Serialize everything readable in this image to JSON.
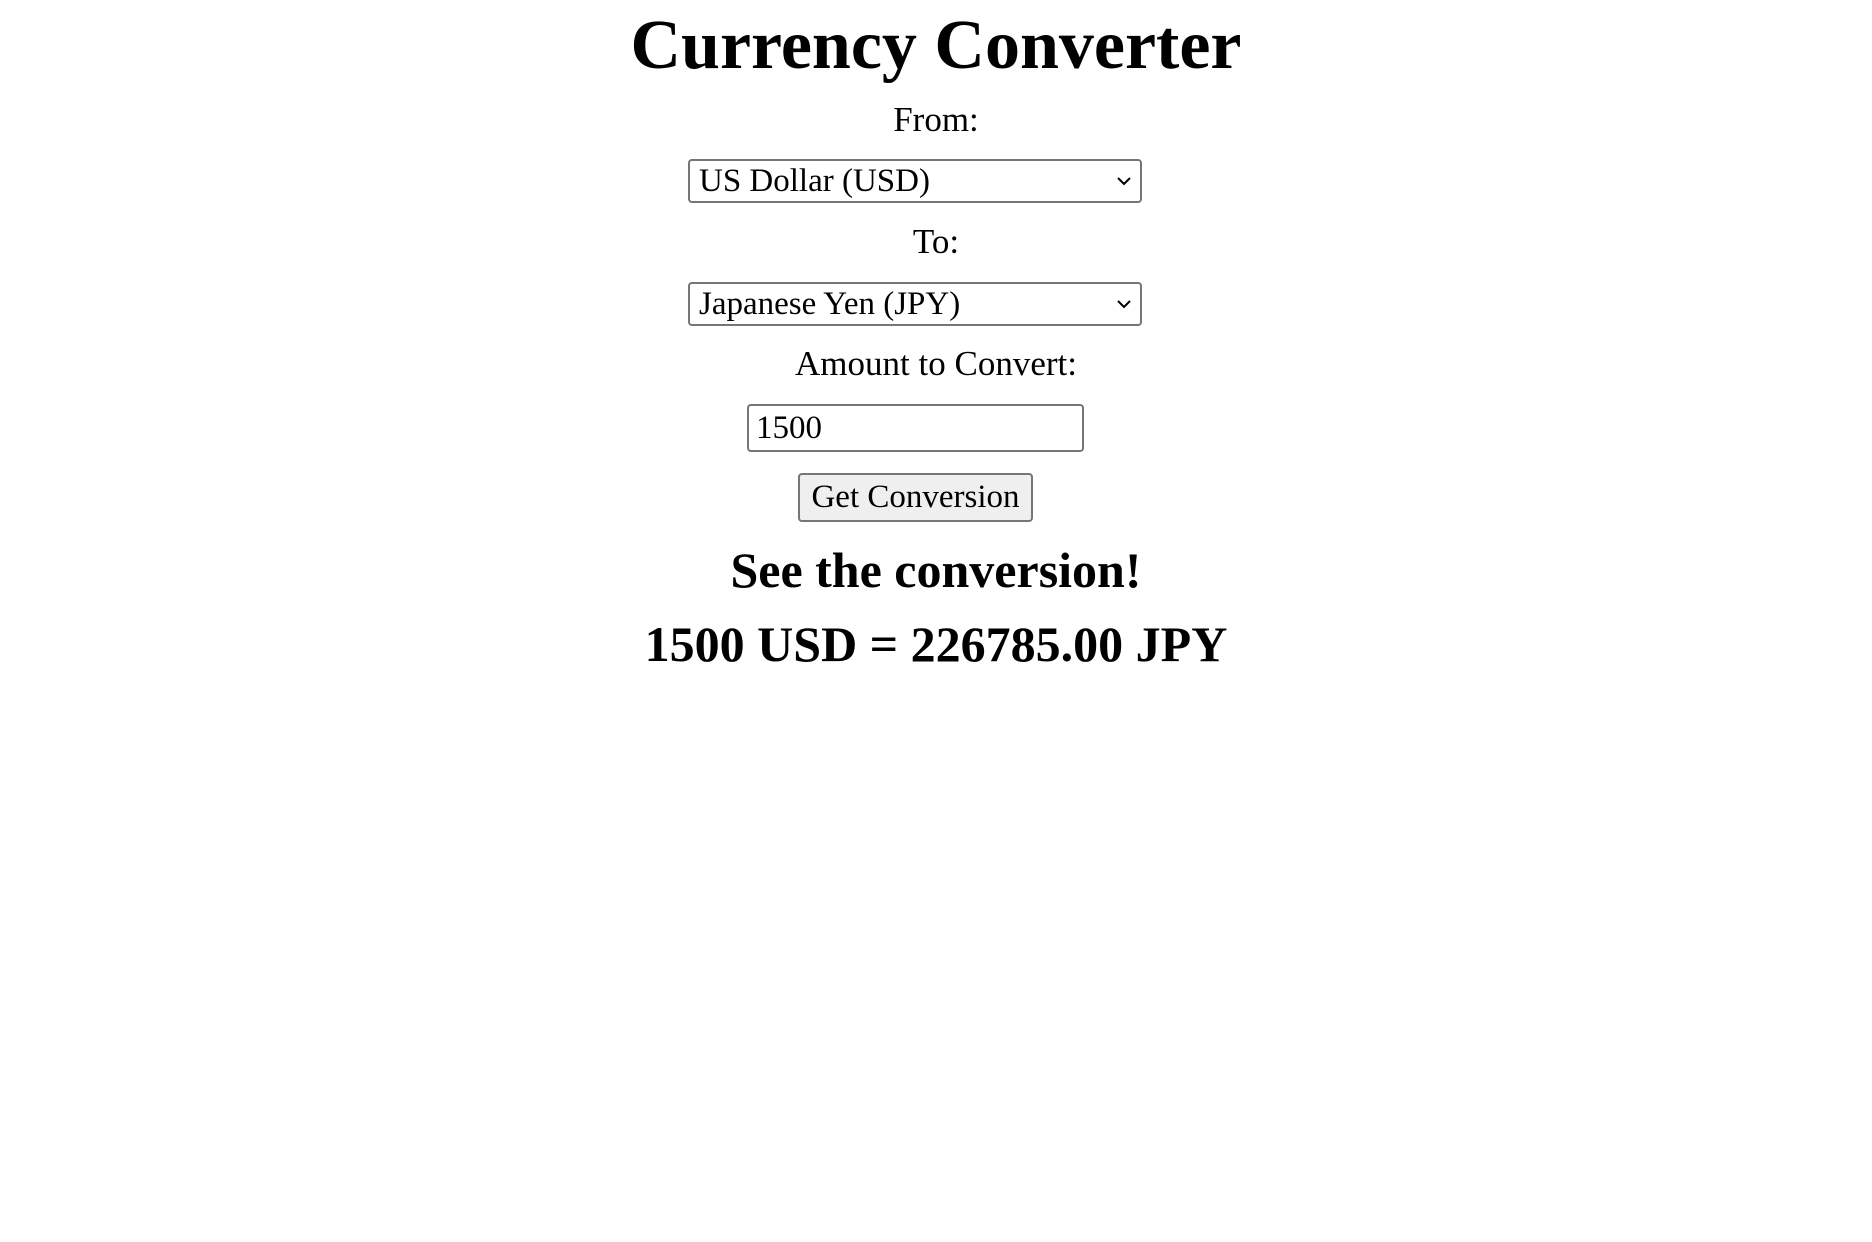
{
  "page": {
    "title": "Currency Converter"
  },
  "form": {
    "from_label": "From:",
    "from_value": "US Dollar (USD)",
    "to_label": "To:",
    "to_value": "Japanese Yen (JPY)",
    "amount_label": "Amount to Convert:",
    "amount_value": "1500",
    "submit_label": "Get Conversion"
  },
  "result": {
    "heading": "See the conversion!",
    "text": "1500 USD = 226785.00 JPY"
  },
  "icons": {
    "select_chevron": "chevron-down-icon"
  }
}
